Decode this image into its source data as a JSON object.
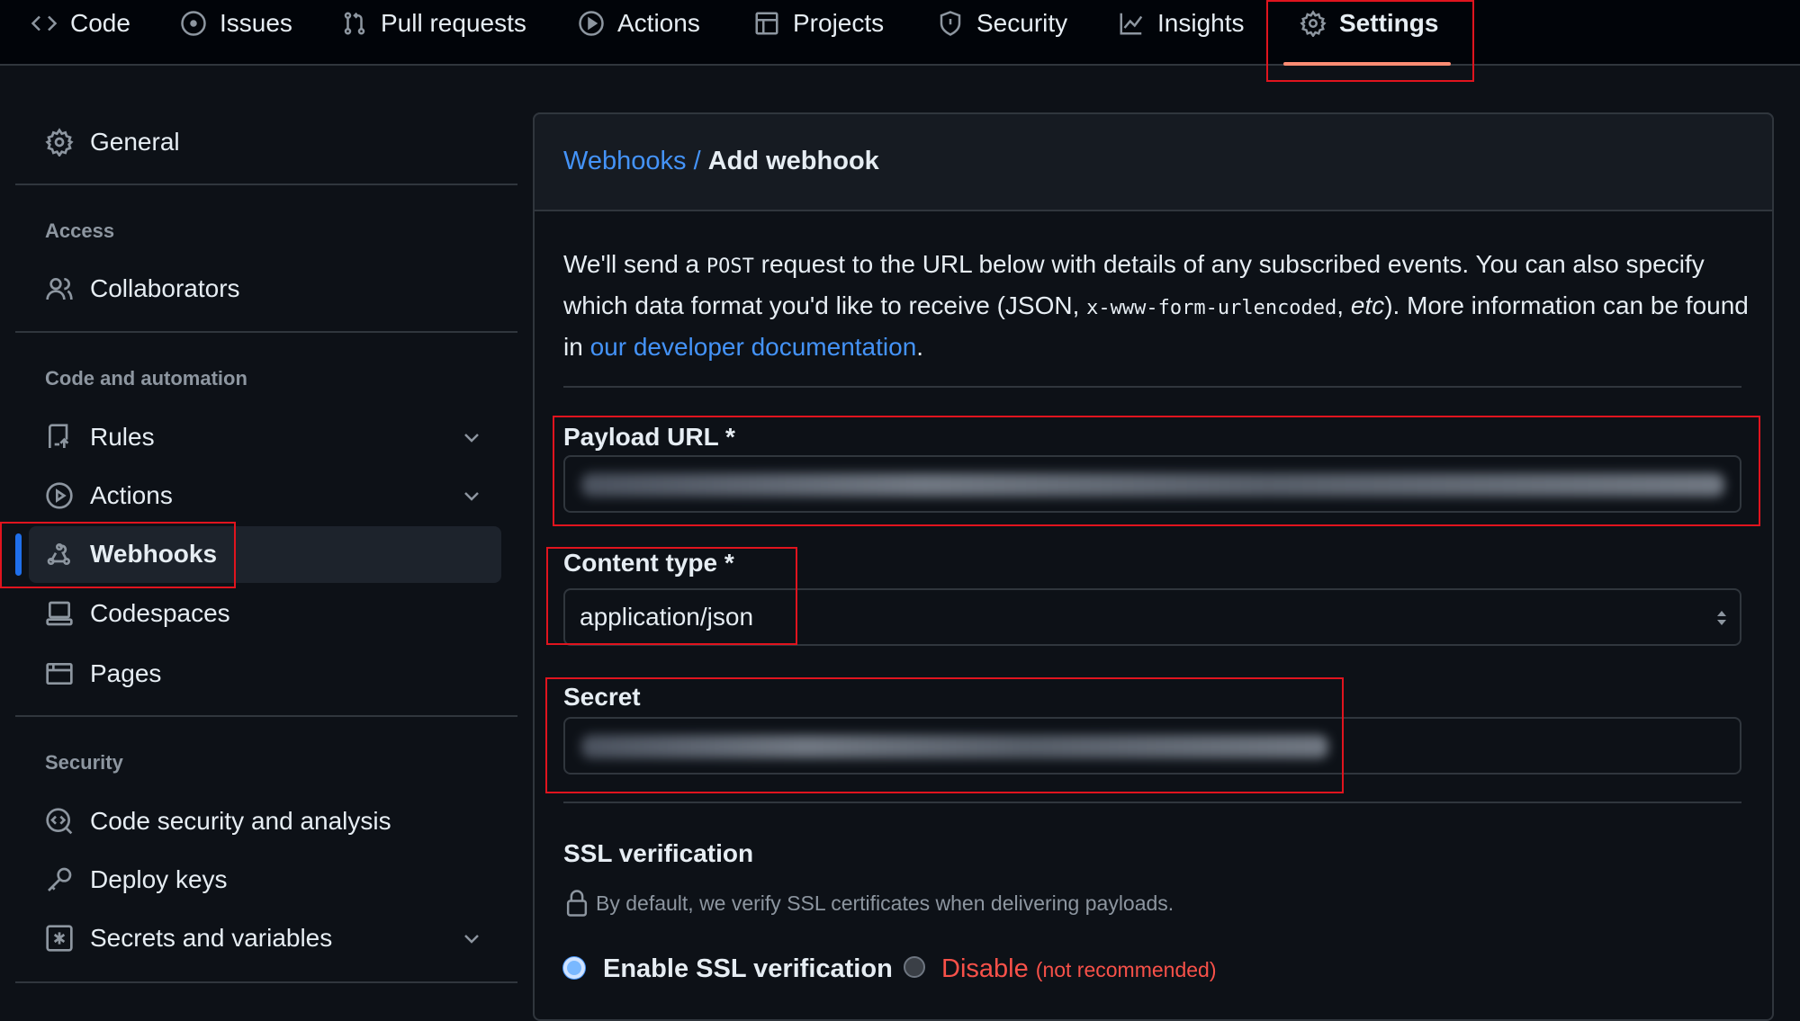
{
  "topnav": {
    "items": [
      {
        "label": "Code",
        "icon": "code-icon"
      },
      {
        "label": "Issues",
        "icon": "issue-opened-icon"
      },
      {
        "label": "Pull requests",
        "icon": "git-pull-request-icon"
      },
      {
        "label": "Actions",
        "icon": "play-icon"
      },
      {
        "label": "Projects",
        "icon": "table-icon"
      },
      {
        "label": "Security",
        "icon": "shield-icon"
      },
      {
        "label": "Insights",
        "icon": "graph-icon"
      },
      {
        "label": "Settings",
        "icon": "gear-icon",
        "selected": true
      }
    ]
  },
  "sidebar": {
    "general": "General",
    "access_header": "Access",
    "collaborators": "Collaborators",
    "automation_header": "Code and automation",
    "rules": "Rules",
    "actions": "Actions",
    "webhooks": "Webhooks",
    "codespaces": "Codespaces",
    "pages": "Pages",
    "security_header": "Security",
    "code_security": "Code security and analysis",
    "deploy_keys": "Deploy keys",
    "secrets": "Secrets and variables"
  },
  "main": {
    "breadcrumb_link": "Webhooks",
    "breadcrumb_sep": "/",
    "title": "Add webhook",
    "desc_1": "We'll send a ",
    "desc_post": "POST",
    "desc_2": " request to the URL below with details of any subscribed events. You can also specify which data format you'd like to receive (JSON, ",
    "desc_form": "x-www-form-urlencoded",
    "desc_3": ", ",
    "desc_etc": "etc",
    "desc_4": "). More information can be found in ",
    "desc_link": "our developer documentation",
    "desc_5": ".",
    "payload_label": "Payload URL *",
    "content_type_label": "Content type *",
    "content_type_value": "application/json",
    "secret_label": "Secret",
    "ssl_heading": "SSL verification",
    "ssl_note": "By default, we verify SSL certificates when delivering payloads.",
    "enable_ssl": "Enable SSL verification",
    "disable": "Disable",
    "disable_note": "(not recommended)",
    "ssl_selected": "enable"
  },
  "colors": {
    "accent": "#4493f8",
    "danger": "#f85149",
    "annotation": "#e0141e",
    "bg": "#0d1117"
  }
}
